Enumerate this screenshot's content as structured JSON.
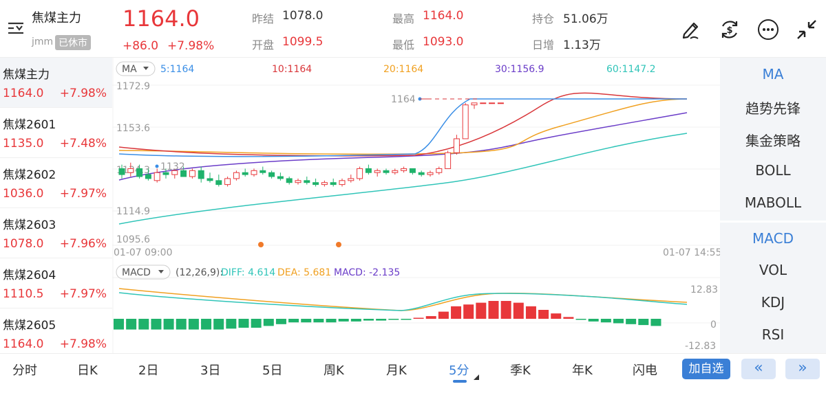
{
  "header": {
    "name": "焦煤主力",
    "code": "jmm",
    "status_badge": "已休市",
    "price": "1164.0",
    "change": "+86.0",
    "change_pct": "+7.98%",
    "stats": [
      {
        "label": "昨结",
        "value": "1078.0",
        "color": "#333333"
      },
      {
        "label": "最高",
        "value": "1164.0",
        "color": "#e8373a"
      },
      {
        "label": "持仓",
        "value": "51.06万",
        "color": "#333333"
      },
      {
        "label": "开盘",
        "value": "1099.5",
        "color": "#e8373a"
      },
      {
        "label": "最低",
        "value": "1093.0",
        "color": "#e8373a"
      },
      {
        "label": "日增",
        "value": "1.13万",
        "color": "#333333"
      }
    ],
    "icons": [
      "draw-pen-icon",
      "currency-cycle-icon",
      "more-icon",
      "collapse-icon"
    ]
  },
  "watchlist": [
    {
      "name": "焦煤主力",
      "price": "1164.0",
      "pct": "+7.98%",
      "selected": true
    },
    {
      "name": "焦煤2601",
      "price": "1135.0",
      "pct": "+7.48%"
    },
    {
      "name": "焦煤2602",
      "price": "1036.0",
      "pct": "+7.97%"
    },
    {
      "name": "焦煤2603",
      "price": "1078.0",
      "pct": "+7.96%"
    },
    {
      "name": "焦煤2604",
      "price": "1110.5",
      "pct": "+7.97%"
    },
    {
      "name": "焦煤2605",
      "price": "1164.0",
      "pct": "+7.98%"
    }
  ],
  "main_chart": {
    "indicator_dropdown": "MA",
    "ma_legend": [
      {
        "text": "5:1164",
        "color": "#3a8ee6"
      },
      {
        "text": "10:1164",
        "color": "#d9363a"
      },
      {
        "text": "20:1164",
        "color": "#f0a020"
      },
      {
        "text": "30:1156.9",
        "color": "#6a3cc8"
      },
      {
        "text": "60:1147.2",
        "color": "#2fc4b8"
      }
    ],
    "y_ticks": [
      "1172.9",
      "1153.6",
      "1134.3",
      "1114.9",
      "1095.6"
    ],
    "x_start": "01-07 09:00",
    "x_end": "01-07 14:55",
    "high_marker": "1164",
    "low_marker": "1132"
  },
  "chart_data": {
    "type": "candlestick",
    "ylim": [
      1095.6,
      1172.9
    ],
    "candles": [
      [
        1131,
        1133,
        1126,
        1128
      ],
      [
        1129,
        1134,
        1127,
        1131
      ],
      [
        1131,
        1133,
        1126,
        1127
      ],
      [
        1128,
        1131,
        1125,
        1126
      ],
      [
        1125,
        1131,
        1124,
        1129
      ],
      [
        1129,
        1131,
        1126,
        1128
      ],
      [
        1128,
        1131,
        1126,
        1130
      ],
      [
        1130,
        1132,
        1127,
        1127
      ],
      [
        1127,
        1131,
        1126,
        1130
      ],
      [
        1130,
        1132,
        1124,
        1126
      ],
      [
        1126,
        1129,
        1124,
        1125
      ],
      [
        1125,
        1128,
        1122,
        1123
      ],
      [
        1123,
        1127,
        1122,
        1126
      ],
      [
        1126,
        1130,
        1125,
        1129
      ],
      [
        1129,
        1131,
        1127,
        1128
      ],
      [
        1128,
        1131,
        1127,
        1130
      ],
      [
        1130,
        1132,
        1128,
        1129
      ],
      [
        1129,
        1130,
        1126,
        1127
      ],
      [
        1127,
        1129,
        1125,
        1126
      ],
      [
        1126,
        1127,
        1123,
        1124
      ],
      [
        1124,
        1126,
        1123,
        1125
      ],
      [
        1125,
        1127,
        1123,
        1124
      ],
      [
        1124,
        1126,
        1122,
        1123
      ],
      [
        1123,
        1125,
        1122,
        1124
      ],
      [
        1124,
        1126,
        1122,
        1123
      ],
      [
        1123,
        1126,
        1122,
        1125
      ],
      [
        1125,
        1128,
        1124,
        1126
      ],
      [
        1126,
        1132,
        1125,
        1131
      ],
      [
        1131,
        1133,
        1128,
        1129
      ],
      [
        1129,
        1131,
        1127,
        1130
      ],
      [
        1130,
        1131,
        1128,
        1129
      ],
      [
        1129,
        1131,
        1128,
        1130
      ],
      [
        1130,
        1132,
        1129,
        1131
      ],
      [
        1131,
        1131,
        1128,
        1129
      ],
      [
        1129,
        1130,
        1127,
        1128
      ],
      [
        1128,
        1130,
        1127,
        1129
      ],
      [
        1129,
        1132,
        1128,
        1131
      ],
      [
        1131,
        1140,
        1131,
        1139
      ],
      [
        1139,
        1148,
        1138,
        1146
      ],
      [
        1146,
        1164,
        1146,
        1163
      ],
      [
        1163,
        1164,
        1161,
        1164
      ],
      [
        1164,
        1164,
        1164,
        1164
      ],
      [
        1164,
        1164,
        1164,
        1164
      ],
      [
        1164,
        1164,
        1164,
        1164
      ]
    ]
  },
  "macd": {
    "dropdown": "MACD",
    "params": "(12,26,9):",
    "diff": "DIFF: 4.614",
    "dea": "DEA: 5.681",
    "macd": "MACD: -2.135",
    "y_ticks": [
      "12.83",
      "0",
      "-12.83"
    ]
  },
  "indicator_panel": {
    "main": [
      "MA",
      "趋势先锋",
      "集金策略",
      "BOLL",
      "MABOLL"
    ],
    "sub": [
      "MACD",
      "VOL",
      "KDJ",
      "RSI"
    ]
  },
  "bottom_tabs": [
    "分时",
    "日K",
    "2日",
    "3日",
    "5日",
    "周K",
    "月K",
    "5分",
    "季K",
    "年K",
    "闪电"
  ],
  "active_tab": "5分",
  "add_watch": "加自选",
  "nav_prev": "«",
  "nav_next": "»"
}
